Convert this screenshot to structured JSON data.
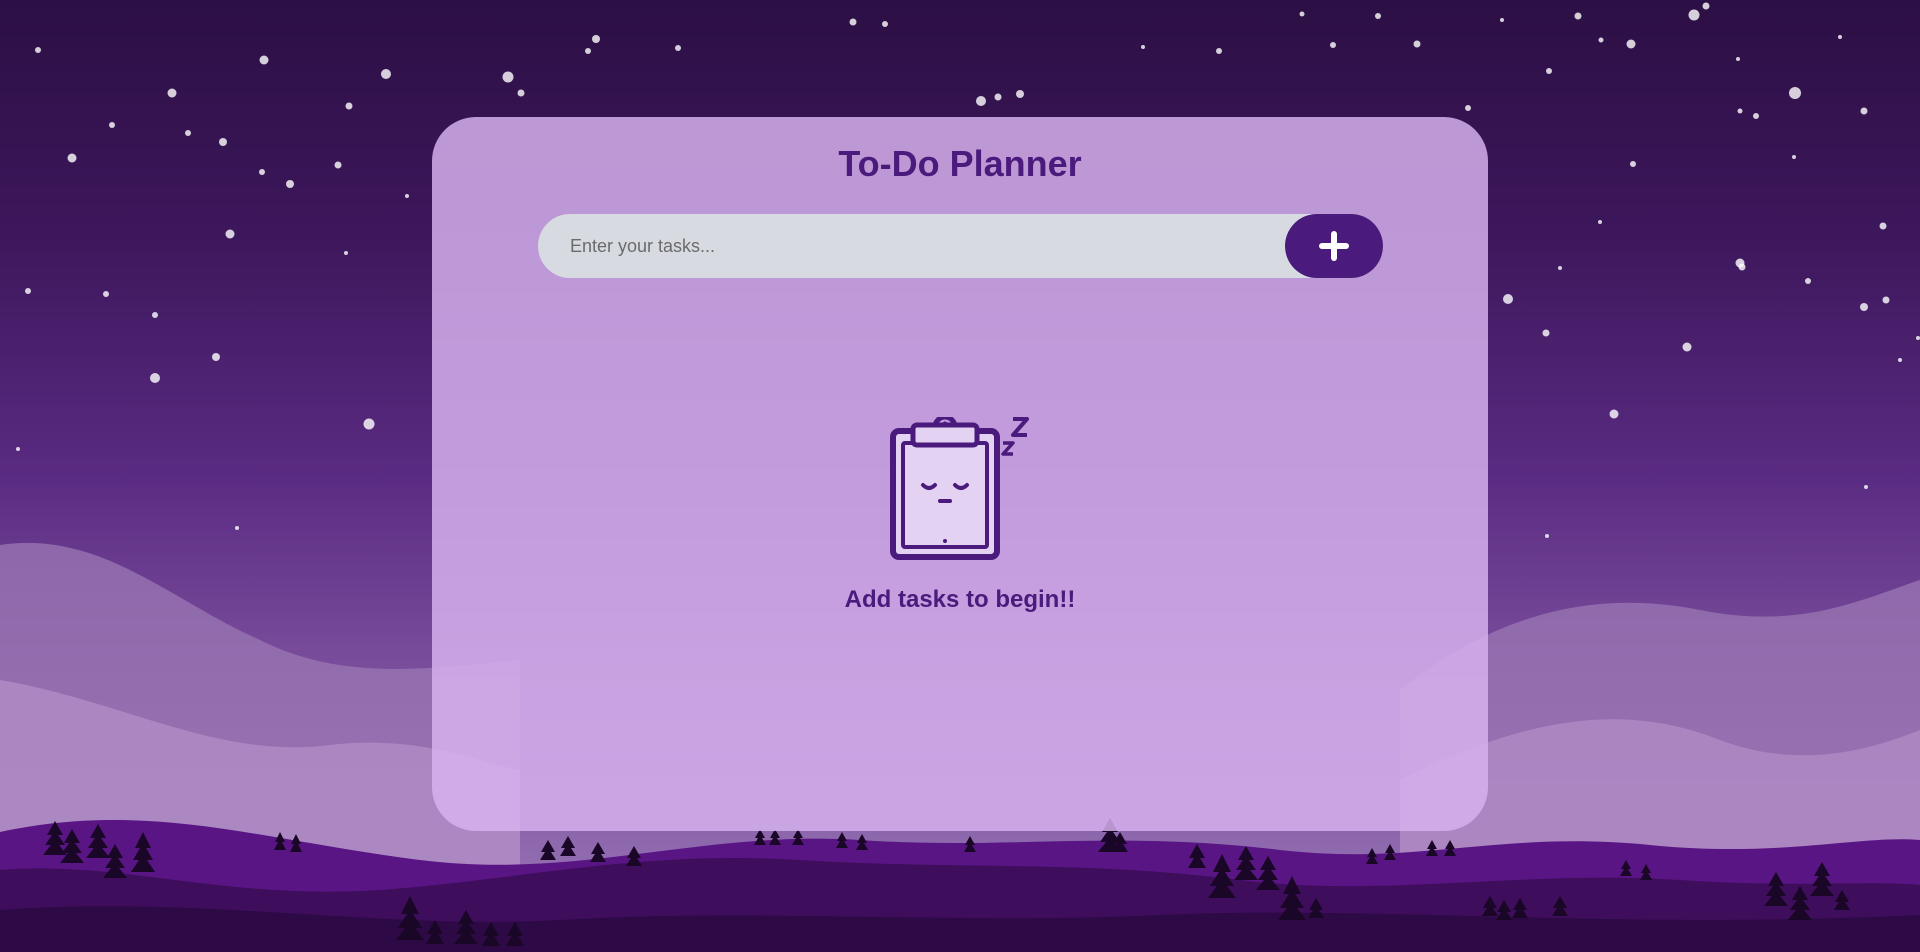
{
  "app": {
    "title": "To-Do Planner"
  },
  "task_input": {
    "placeholder": "Enter your tasks...",
    "value": ""
  },
  "add_button": {
    "icon": "plus-icon"
  },
  "empty_state": {
    "icon": "sleeping-clipboard-icon",
    "message": "Add tasks to begin!!"
  },
  "colors": {
    "accent": "#4a1b7c",
    "card": "#c8a1dc",
    "input": "#d7dbe1",
    "sky_top": "#2c0f44"
  }
}
